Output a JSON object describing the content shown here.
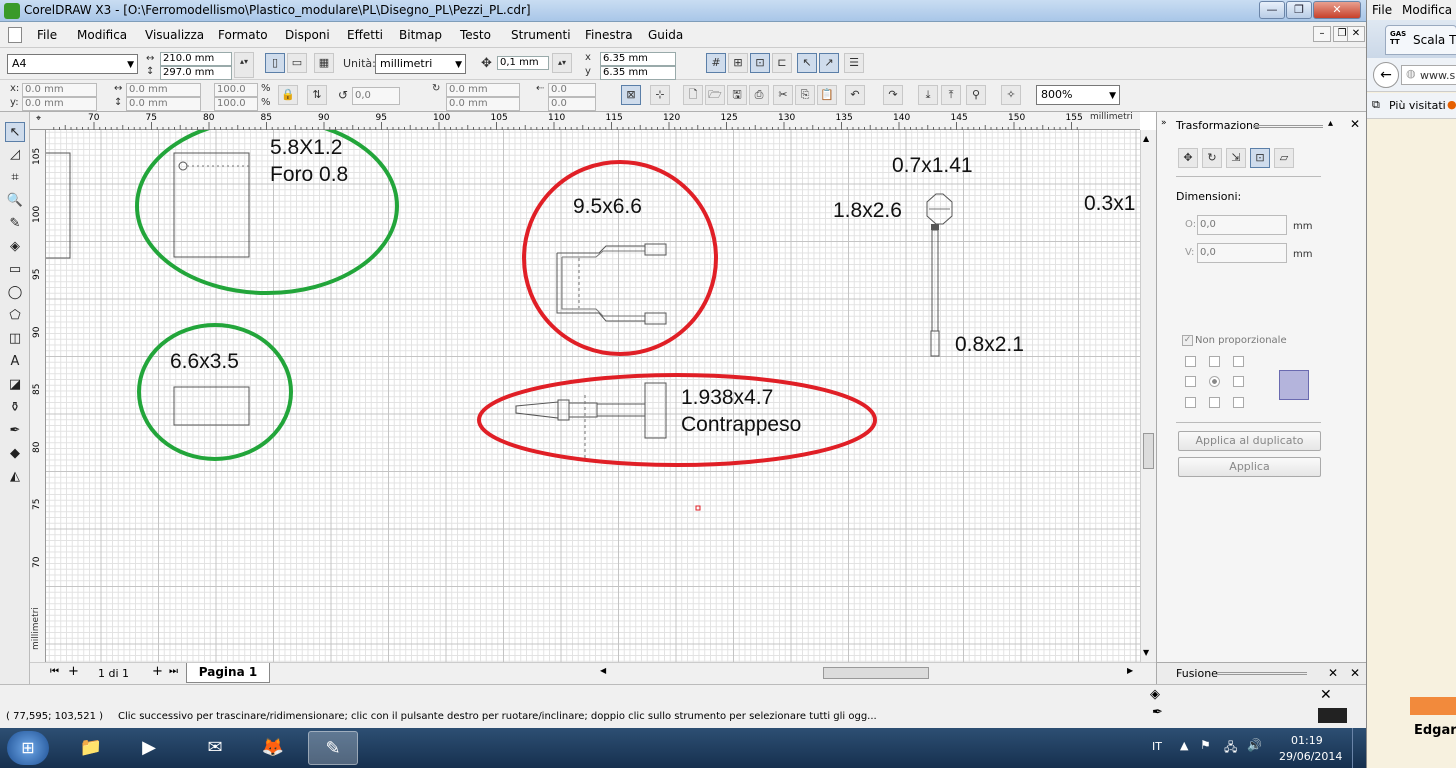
{
  "window": {
    "title": "CorelDRAW X3 - [O:\\Ferromodellismo\\Plastico_modulare\\PL\\Disegno_PL\\Pezzi_PL.cdr]",
    "min": "—",
    "max": "❐",
    "close": "✕"
  },
  "menu": [
    "File",
    "Modifica",
    "Visualizza",
    "Formato",
    "Disponi",
    "Effetti",
    "Bitmap",
    "Testo",
    "Strumenti",
    "Finestra",
    "Guida"
  ],
  "toolbar1": {
    "paper": "A4",
    "width": "210.0 mm",
    "height": "297.0 mm",
    "units_label": "Unità:",
    "units": "millimetri",
    "nudge": "0,1 mm",
    "dup_x": "6.35 mm",
    "dup_y": "6.35 mm"
  },
  "toolbar2": {
    "x": "0.0 mm",
    "y": "0.0 mm",
    "w": "0.0 mm",
    "h": "0.0 mm",
    "scale_w": "100.0",
    "scale_h": "100.0",
    "pct": "%",
    "angle": "0,0",
    "pos_x": "0.0 mm",
    "pos_y": "0.0 mm",
    "skew_x": "0.0",
    "skew_y": "0.0",
    "zoom": "800%"
  },
  "ruler": {
    "h_ticks": [
      "70",
      "75",
      "80",
      "85",
      "90",
      "95",
      "100",
      "105",
      "110",
      "115",
      "120",
      "125",
      "130",
      "135",
      "140",
      "145",
      "150",
      "155"
    ],
    "h_unit": "millimetri",
    "v_ticks": [
      "105",
      "100",
      "95",
      "90",
      "85",
      "80",
      "75",
      "70"
    ],
    "v_unit": "millimetri"
  },
  "drawing_labels": {
    "part1_size": "5.8X1.2",
    "part1_hole": "Foro 0.8",
    "part2_size": "6.6x3.5",
    "part3_size": "9.5x6.6",
    "part4_size": "1.938x4.7",
    "part4_name": "Contrappeso",
    "part5_top": "0.7x1.41",
    "part5_head": "1.8x2.6",
    "part5_bottom": "0.8x2.1",
    "edge_text": "0.3x1"
  },
  "annotation_colors": {
    "green": "#22a53a",
    "red": "#e01f26"
  },
  "pages": {
    "counter": "1 di 1",
    "tab": "Pagina 1"
  },
  "docker": {
    "title": "Trasformazione",
    "section": "Dimensioni:",
    "h_label": "O:",
    "h_value": "0,0",
    "v_label": "V:",
    "v_value": "0,0",
    "unit": "mm",
    "nonprop": "Non proporzionale",
    "apply_dup": "Applica al duplicato",
    "apply": "Applica",
    "fusion": "Fusione"
  },
  "status": {
    "coords": "( 77,595; 103,521 )",
    "hint": "Clic successivo per trascinare/ridimensionare; clic con il pulsante destro per ruotare/inclinare; doppio clic sullo strumento per selezionare tutti gli ogg..."
  },
  "taskbar": {
    "lang": "IT",
    "time": "01:19",
    "date": "29/06/2014"
  },
  "browser": {
    "menu_file": "File",
    "menu_mod": "Modifica",
    "tab": "Scala TT",
    "addr": "www.s",
    "bookmarks": "Più visitati",
    "user": "Edgar"
  }
}
